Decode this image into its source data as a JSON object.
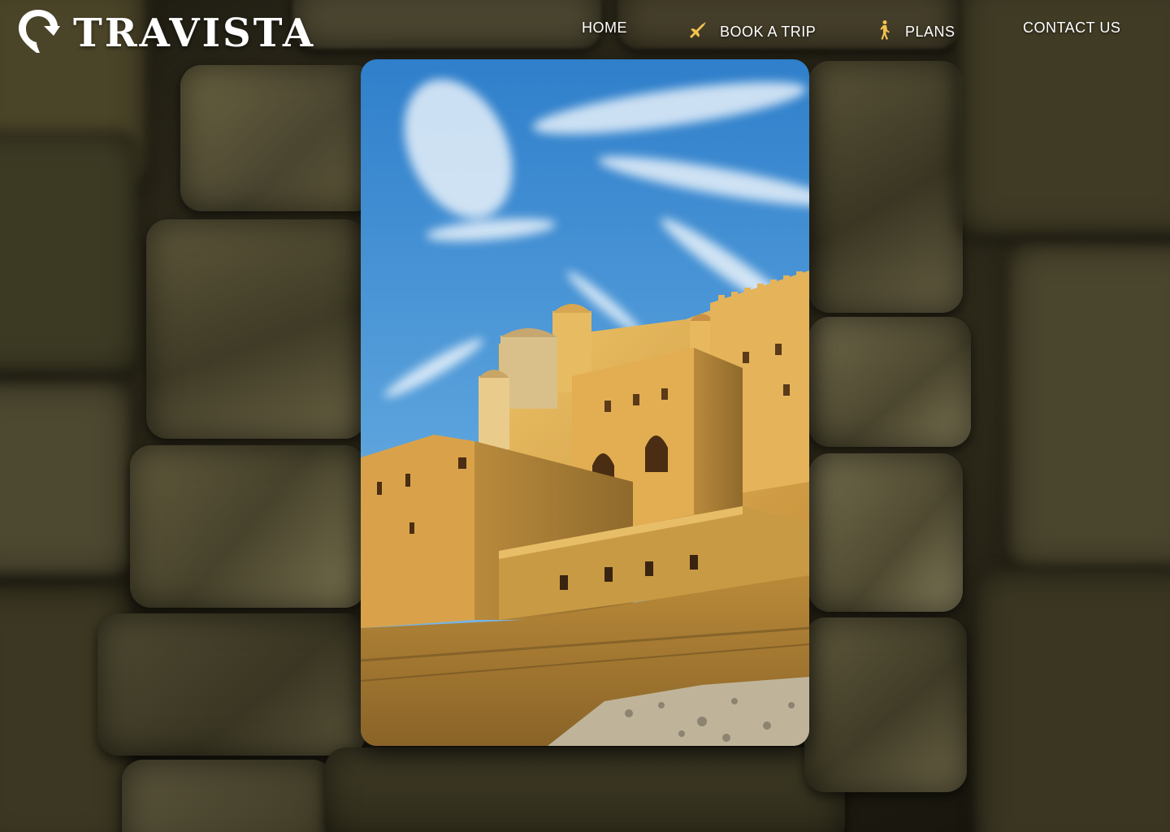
{
  "brand": {
    "name": "TRAVISTA",
    "logo_icon": "map-pin-icon"
  },
  "nav": {
    "items": [
      {
        "label": "HOME",
        "icon": ""
      },
      {
        "label": "BOOK A TRIP",
        "icon": "airplane-icon"
      },
      {
        "label": "PLANS",
        "icon": "hiker-icon"
      },
      {
        "label": "CONTACT US",
        "icon": ""
      }
    ]
  },
  "hero": {
    "image_subject": "fort-photo"
  },
  "colors": {
    "nav_text": "#ffffff",
    "icon_accent": "#f2c14e",
    "sky": "#3f8fd6",
    "sandstone": "#d9a94b"
  }
}
